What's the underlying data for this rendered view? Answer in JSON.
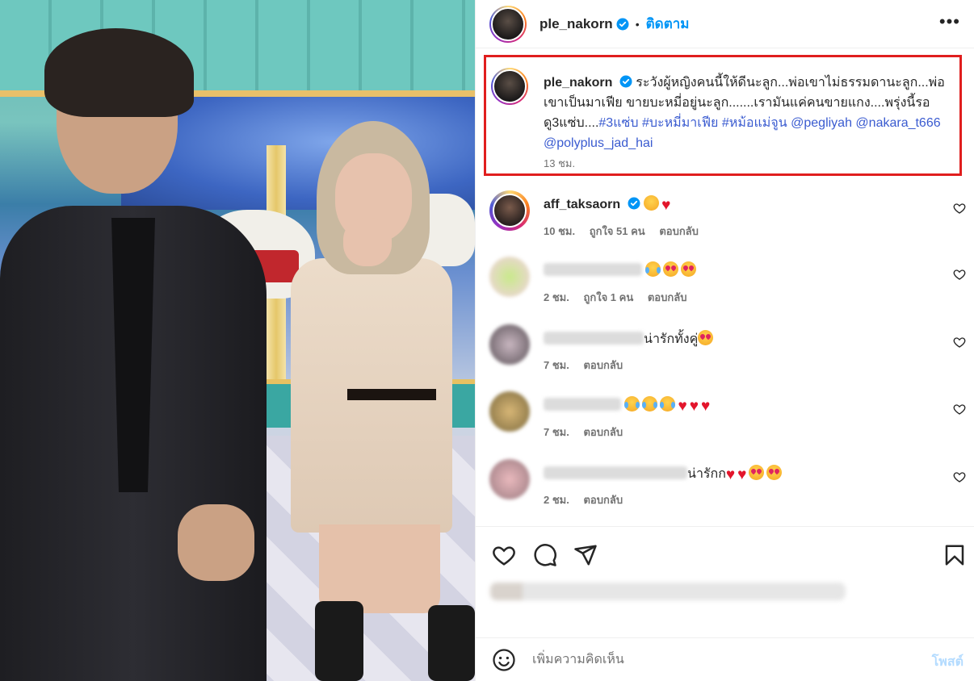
{
  "post": {
    "username": "ple_nakorn",
    "follow_label": "ติดตาม",
    "dot": "•",
    "more": "•••"
  },
  "caption": {
    "username": "ple_nakorn",
    "text_1": "ระวังผู้หญิงคนนี้ให้ดีนะลูก...พ่อเขาไม่ธรรมดานะลูก...พ่อเขาเป็นมาเฟีย ขายบะหมี่อยู่นะลูก.......เรามันแค่คนขายแกง....พรุ่งนี้รอดู3แซ่บ....",
    "hashtags": [
      "#3แซ่บ",
      "#บะหมี่มาเฟีย",
      "#หม้อแม่จูน"
    ],
    "mentions": [
      "@pegliyah",
      "@nakara_t666",
      "@polyplus_jad_hai"
    ],
    "time": "13 ชม."
  },
  "comments": [
    {
      "username": "aff_taksaorn",
      "verified": true,
      "emojis": [
        "grin",
        "heart"
      ],
      "time": "10 ชม.",
      "likes": "ถูกใจ 51 คน",
      "reply": "ตอบกลับ"
    },
    {
      "username": "",
      "text": "",
      "emojis": [
        "tear",
        "love",
        "love"
      ],
      "time": "2 ชม.",
      "likes": "ถูกใจ 1 คน",
      "reply": "ตอบกลับ"
    },
    {
      "username": "",
      "text": "น่ารักทั้งคู่",
      "emojis": [
        "love"
      ],
      "time": "7 ชม.",
      "likes": "",
      "reply": "ตอบกลับ"
    },
    {
      "username": "",
      "text": "",
      "emojis": [
        "tear",
        "tear",
        "tear",
        "heart",
        "heart",
        "heart"
      ],
      "time": "7 ชม.",
      "likes": "",
      "reply": "ตอบกลับ"
    },
    {
      "username": "",
      "text": "น่ารักก",
      "emojis": [
        "heart",
        "heart",
        "love",
        "love"
      ],
      "time": "2 ชม.",
      "likes": "",
      "reply": "ตอบกลับ"
    }
  ],
  "composer": {
    "placeholder": "เพิ่มความคิดเห็น",
    "post_label": "โพสต์"
  },
  "colors": {
    "accent": "#0095f6",
    "highlight_box": "#e01e1e",
    "heart": "#e3152b"
  }
}
